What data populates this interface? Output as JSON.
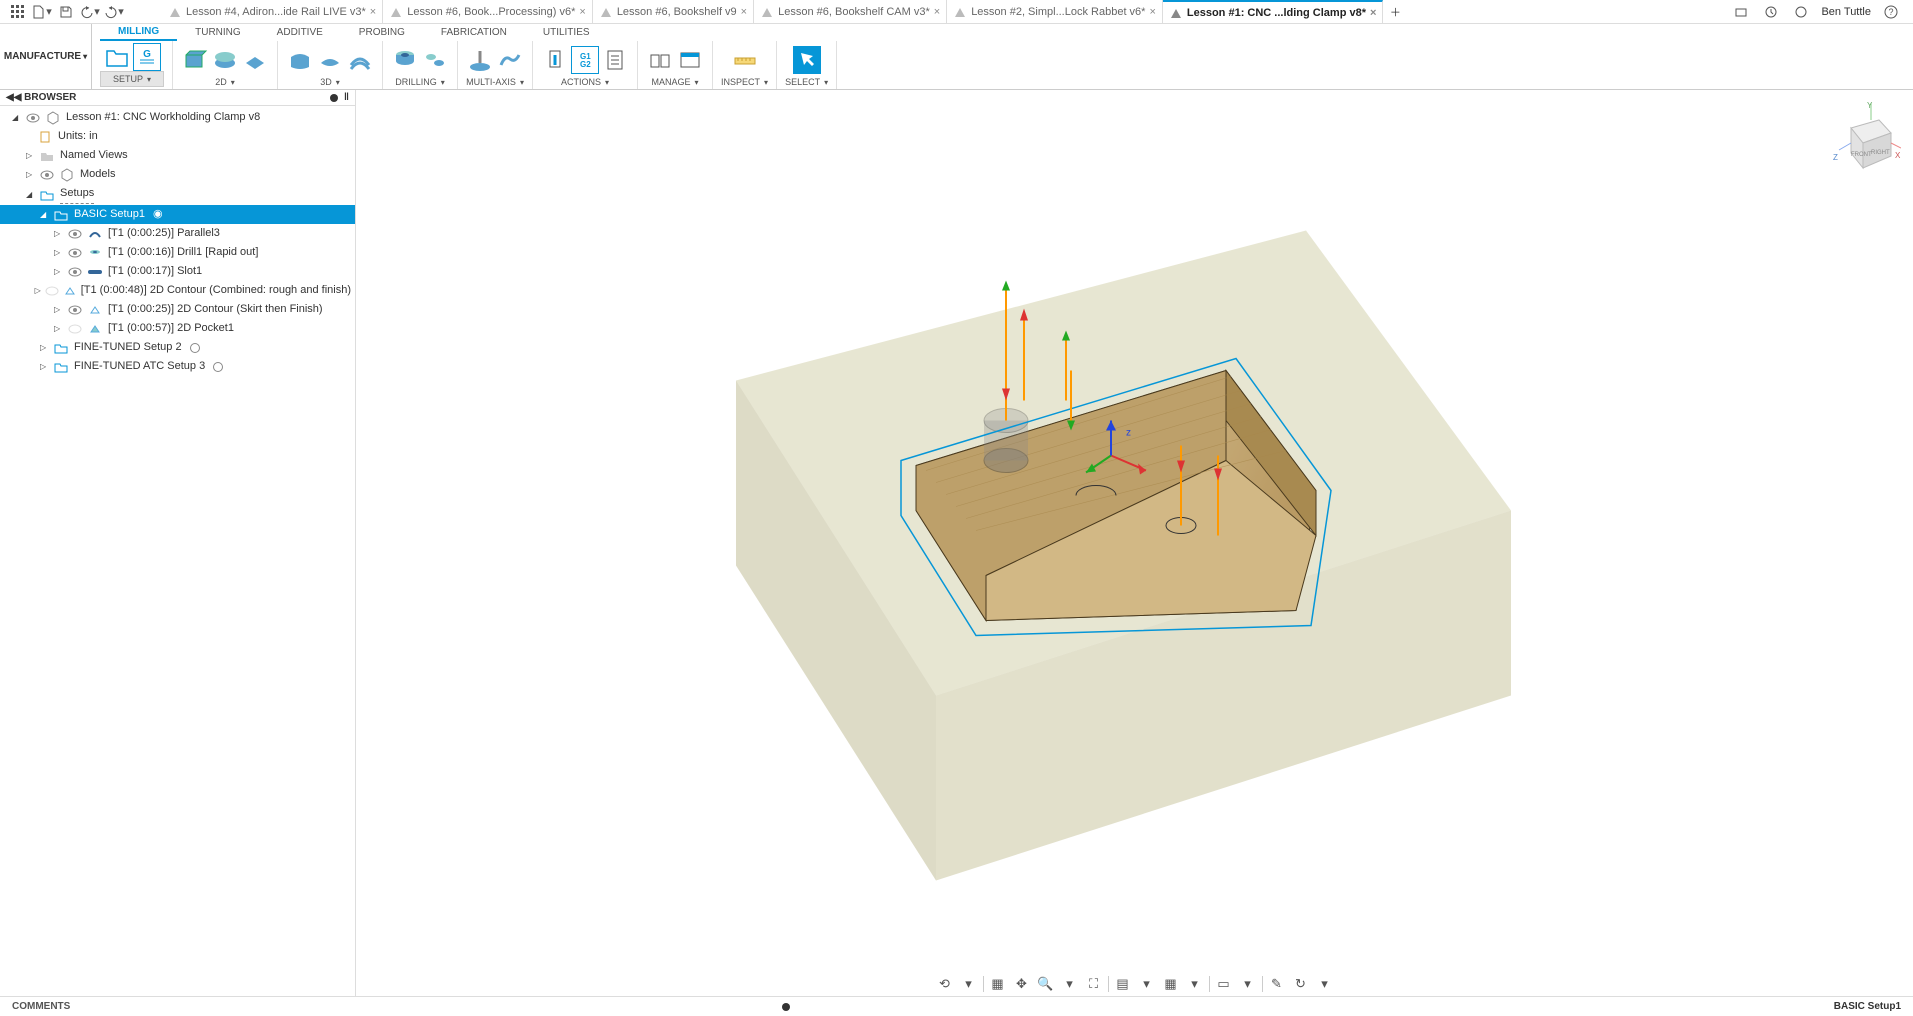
{
  "titlebar": {
    "user": "Ben Tuttle",
    "tabs": [
      {
        "label": "Lesson #4, Adiron...ide Rail LIVE v3*",
        "close": "×"
      },
      {
        "label": "Lesson #6, Book...Processing) v6*",
        "close": "×"
      },
      {
        "label": "Lesson #6,  Bookshelf v9",
        "close": "×"
      },
      {
        "label": "Lesson #6, Bookshelf CAM v3*",
        "close": "×"
      },
      {
        "label": "Lesson #2, Simpl...Lock Rabbet v6*",
        "close": "×"
      },
      {
        "label": "Lesson #1: CNC ...lding Clamp v8*",
        "close": "×",
        "active": true
      }
    ]
  },
  "workspace_label": "MANUFACTURE",
  "ribbon": {
    "tabs": [
      "MILLING",
      "TURNING",
      "ADDITIVE",
      "PROBING",
      "FABRICATION",
      "UTILITIES"
    ],
    "active_tab": "MILLING",
    "groups": [
      {
        "label": "SETUP"
      },
      {
        "label": "2D"
      },
      {
        "label": "3D"
      },
      {
        "label": "DRILLING"
      },
      {
        "label": "MULTI-AXIS"
      },
      {
        "label": "ACTIONS"
      },
      {
        "label": "MANAGE"
      },
      {
        "label": "INSPECT"
      },
      {
        "label": "SELECT"
      }
    ]
  },
  "browser": {
    "title": "BROWSER",
    "root": "Lesson #1: CNC Workholding Clamp v8",
    "units": "Units: in",
    "named_views": "Named Views",
    "models": "Models",
    "setups": "Setups",
    "basic_setup": "BASIC Setup1",
    "ops": [
      "[T1 (0:00:25)] Parallel3",
      "[T1 (0:00:16)] Drill1 [Rapid out]",
      "[T1 (0:00:17)] Slot1",
      "[T1 (0:00:48)] 2D Contour (Combined: rough and finish)",
      "[T1 (0:00:25)] 2D Contour (Skirt then Finish)",
      "[T1 (0:00:57)] 2D Pocket1"
    ],
    "fine_tuned2": "FINE-TUNED Setup 2",
    "fine_tuned_atc": "FINE-TUNED ATC Setup 3"
  },
  "comments": "COMMENTS",
  "status_right": "BASIC Setup1",
  "viewcube": {
    "front": "FRONT",
    "right": "RIGHT"
  }
}
